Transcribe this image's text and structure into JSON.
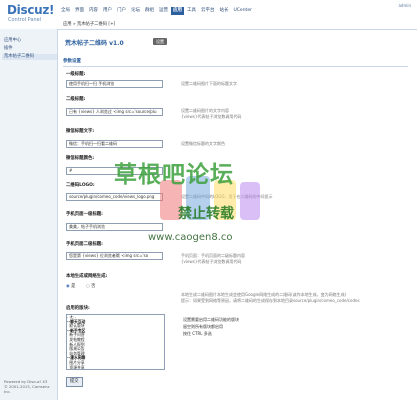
{
  "app": {
    "logo": "Discuz!",
    "subtitle": "Control Panel",
    "top_right": "admin"
  },
  "nav": [
    "全局",
    "界面",
    "内容",
    "用户",
    "门户",
    "论坛",
    "群组",
    "运营",
    "应用",
    "工具",
    "云平台",
    "站长",
    "UCenter"
  ],
  "nav_active": "应用",
  "sidebar": {
    "items": [
      "应用中心",
      "插件",
      "荒木帖子二维码"
    ],
    "active": "荒木帖子二维码",
    "footer1": "Powered by Discuz! X3",
    "footer2": "© 2001-2013, Comsenz Inc."
  },
  "breadcrumb": "应用 » 荒木帖子二维码 [+]",
  "page": {
    "title": "荒木帖子二维码 v1.0",
    "badge": "设置",
    "tab": "参数设置",
    "submit": "提交"
  },
  "fields": [
    {
      "label": "一级标题:",
      "value": "使用手机扫一扫 手机浏览",
      "hint": "设置二维码图片下面的标题文字"
    },
    {
      "label": "二级标题:",
      "value": "已有 {views} 人浏览过 <img src='source/plu",
      "hint": "设置二维码图片的文字内容",
      "hint2": "{views}代表帖子浏览数调用代码"
    },
    {
      "label": "微信标题文字:",
      "value": "微信：手机扫一扫看二维码",
      "hint": "设置微信标题的文字颜色"
    },
    {
      "label": "微信标题颜色:",
      "value": "#",
      "hint": ""
    },
    {
      "label": "二维码LOGO:",
      "value": "source/plugin/comeo_code/views_logo.png",
      "hint": "设置二维码中间的LOGO，用于在二维码的中间显示"
    },
    {
      "label": "手机页面一级标题:",
      "value": "美美，帖子手机浏览",
      "hint": ""
    },
    {
      "label": "手机页面二级标题:",
      "value": "您是第 {views} 位浏览者哦 <img src='so",
      "hint": "手机页面：手机页面的二级标题内容",
      "hint2": "{views}代表帖子浏览数调用代码"
    }
  ],
  "network_block": {
    "label": "本地生成或网络生成:",
    "option_yes": "是",
    "option_no": "否",
    "hint": "本地生成二维码图片本地生成会使用Google网络生成的二维码(或作本地生成，变为网络生成)",
    "hint2": "提示：如果受到网络等原因，请将二维码的生成保存到本地目录source/plugin/comeo_code/codes"
  },
  "forum_block": {
    "label": "启用的版块:",
    "options": [
      {
        "text": "- 无 -",
        "type": "item"
      },
      {
        "text": "--聊天互动",
        "type": "grp"
      },
      {
        "text": "  默认版块",
        "type": "item"
      },
      {
        "text": "--新手专区",
        "type": "grp"
      },
      {
        "text": "  新手问答",
        "type": "item"
      },
      {
        "text": "  发帖教程",
        "type": "item"
      },
      {
        "text": "  新人报到",
        "type": "item"
      },
      {
        "text": "  版规公告",
        "type": "item"
      },
      {
        "text": "  站务管理",
        "type": "item"
      },
      {
        "text": "--灌水闲聊",
        "type": "grp"
      },
      {
        "text": "  图片分享",
        "type": "item"
      },
      {
        "text": "  资源共享",
        "type": "item"
      },
      {
        "text": "  生活杂谈",
        "type": "sel"
      }
    ],
    "hint1": "设置需要启用二维码功能的版块",
    "hint2": "留空则所有版块都启用",
    "hint3": "按住 CTRL 多选"
  },
  "watermark": {
    "line1": "草根吧论坛",
    "line2": "禁止转载",
    "line3": "www.caogen8.co"
  },
  "colors": {
    "brand": "#3b74b8",
    "nav_active": "#2b5f9e",
    "watermark": "#3ca03c"
  }
}
